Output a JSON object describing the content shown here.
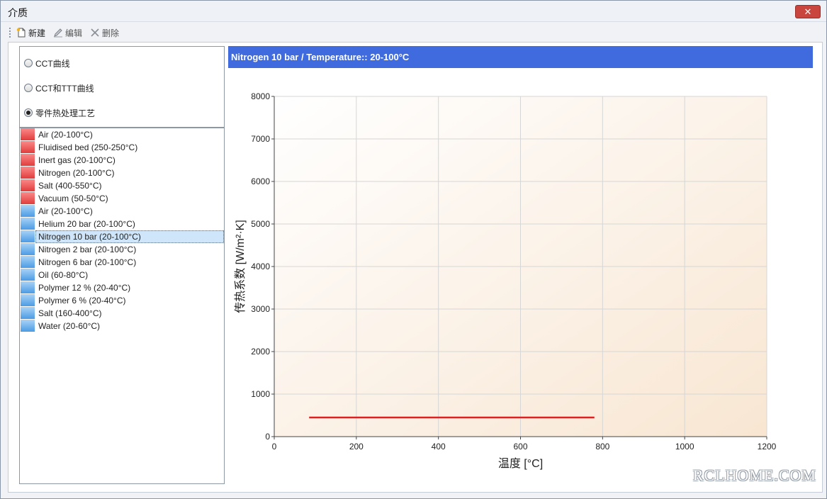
{
  "window": {
    "title": "介质",
    "close_label": "✕"
  },
  "toolbar": {
    "new_label": "新建",
    "edit_label": "编辑",
    "delete_label": "删除"
  },
  "radio_options": [
    {
      "label": "CCT曲线",
      "checked": false
    },
    {
      "label": "CCT和TTT曲线",
      "checked": false
    },
    {
      "label": "零件热处理工艺",
      "checked": true
    }
  ],
  "media_list": [
    {
      "label": "Air (20-100°C)",
      "color": "red"
    },
    {
      "label": "Fluidised bed (250-250°C)",
      "color": "red"
    },
    {
      "label": "Inert gas (20-100°C)",
      "color": "red"
    },
    {
      "label": "Nitrogen (20-100°C)",
      "color": "red"
    },
    {
      "label": "Salt (400-550°C)",
      "color": "red"
    },
    {
      "label": "Vacuum (50-50°C)",
      "color": "red"
    },
    {
      "label": "Air (20-100°C)",
      "color": "blue"
    },
    {
      "label": "Helium 20 bar (20-100°C)",
      "color": "blue"
    },
    {
      "label": "Nitrogen 10 bar (20-100°C)",
      "color": "blue",
      "selected": true
    },
    {
      "label": "Nitrogen 2 bar (20-100°C)",
      "color": "blue"
    },
    {
      "label": "Nitrogen 6 bar (20-100°C)",
      "color": "blue"
    },
    {
      "label": "Oil (60-80°C)",
      "color": "blue"
    },
    {
      "label": "Polymer 12 % (20-40°C)",
      "color": "blue"
    },
    {
      "label": "Polymer 6 % (20-40°C)",
      "color": "blue"
    },
    {
      "label": "Salt (160-400°C)",
      "color": "blue"
    },
    {
      "label": "Water (20-60°C)",
      "color": "blue"
    }
  ],
  "chart_header": "Nitrogen 10 bar / Temperature:: 20-100°C",
  "chart_data": {
    "type": "line",
    "title": "Nitrogen 10 bar / Temperature:: 20-100°C",
    "xlabel": "温度 [°C]",
    "ylabel": "传热系数 [W/m²·K]",
    "xlim": [
      0,
      1200
    ],
    "ylim": [
      0,
      8000
    ],
    "xticks": [
      0,
      200,
      400,
      600,
      800,
      1000,
      1200
    ],
    "yticks": [
      0,
      1000,
      2000,
      3000,
      4000,
      5000,
      6000,
      7000,
      8000
    ],
    "grid": true,
    "series": [
      {
        "color": "#e02020",
        "x": [
          85,
          780
        ],
        "y": [
          450,
          450
        ]
      }
    ]
  },
  "watermark": "RCLHOME.COM"
}
